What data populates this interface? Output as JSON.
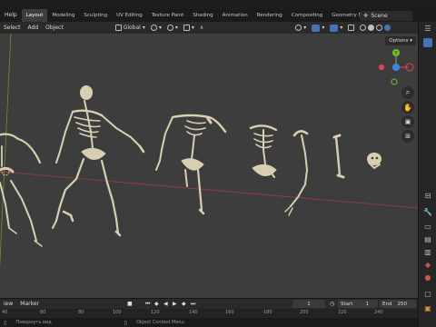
{
  "menu": {
    "help": "Help",
    "workspaces": [
      "Layout",
      "Modeling",
      "Sculpting",
      "UV Editing",
      "Texture Paint",
      "Shading",
      "Animation",
      "Rendering",
      "Compositing",
      "Geometry Nod"
    ],
    "scene": "Scene"
  },
  "viewport_header": {
    "select": "Select",
    "add": "Add",
    "object": "Object",
    "orientation": "Global",
    "options": "Options"
  },
  "timeline": {
    "view": "iew",
    "marker": "Marker",
    "current_frame": "1",
    "start_label": "Start",
    "start_value": "1",
    "end_label": "End",
    "end_value": "250",
    "ruler": [
      "40",
      "60",
      "80",
      "100",
      "120",
      "140",
      "160",
      "180",
      "200",
      "220",
      "240"
    ]
  },
  "status": {
    "left": "Повернуть вид",
    "right": "Object Context Menu"
  },
  "gizmo": {
    "y": "Y",
    "x": "X",
    "z": "Z"
  },
  "colors": {
    "viewport_bg": "#3d3d3d",
    "bone": "#d8cfb2",
    "active_tab": "#3d3d3d",
    "accent_blue": "#4772b3",
    "x_axis": "#e34356",
    "y_axis": "#6fbf2e",
    "z_axis": "#3a87e0"
  }
}
